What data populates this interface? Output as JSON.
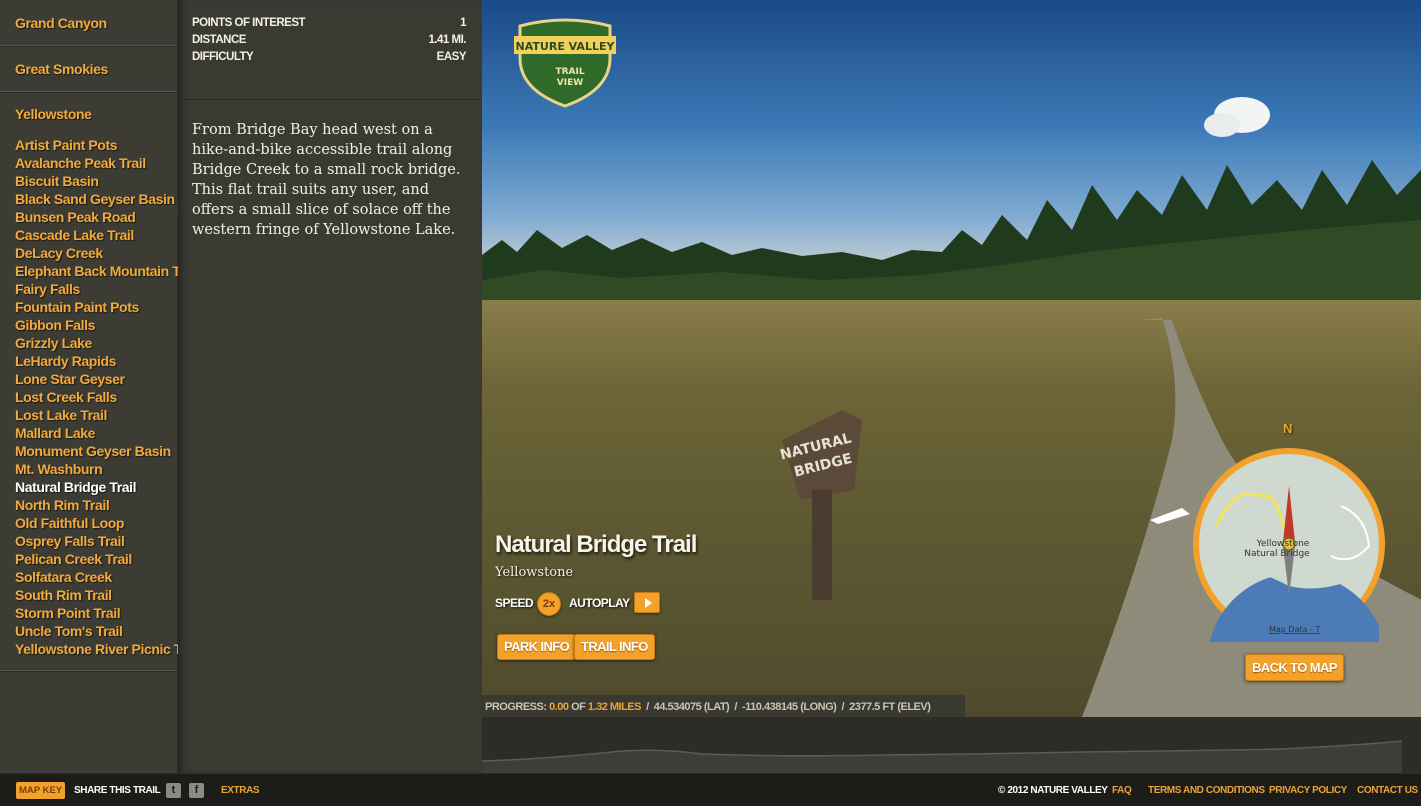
{
  "sidebar": {
    "parks": [
      "Grand Canyon",
      "Great Smokies",
      "Yellowstone"
    ],
    "trails": [
      "Artist Paint Pots",
      "Avalanche Peak Trail",
      "Biscuit Basin",
      "Black Sand Geyser Basin",
      "Bunsen Peak Road",
      "Cascade Lake Trail",
      "DeLacy Creek",
      "Elephant Back Mountain Trail",
      "Fairy Falls",
      "Fountain Paint Pots",
      "Gibbon Falls",
      "Grizzly Lake",
      "LeHardy Rapids",
      "Lone Star Geyser",
      "Lost Creek Falls",
      "Lost Lake Trail",
      "Mallard Lake",
      "Monument Geyser Basin",
      "Mt. Washburn",
      "Natural Bridge Trail",
      "North Rim Trail",
      "Old Faithful Loop",
      "Osprey Falls Trail",
      "Pelican Creek Trail",
      "Solfatara Creek",
      "South Rim Trail",
      "Storm Point Trail",
      "Uncle Tom's Trail",
      "Yellowstone River Picnic Trail"
    ],
    "selected_trail": "Natural Bridge Trail"
  },
  "info": {
    "stats": [
      {
        "label": "POINTS OF INTEREST",
        "value": "1"
      },
      {
        "label": "DISTANCE",
        "value": "1.41 MI."
      },
      {
        "label": "DIFFICULTY",
        "value": "EASY"
      }
    ],
    "description": "From Bridge Bay head west on a hike-and-bike accessible trail along Bridge Creek to a small rock bridge. This flat trail suits any user, and offers a small slice of solace off the western fringe of Yellowstone Lake."
  },
  "view": {
    "logo_text_top": "NATURE VALLEY",
    "logo_text_1": "TRAIL",
    "logo_text_2": "VIEW",
    "sign_text_1": "NATURAL",
    "sign_text_2": "BRIDGE",
    "trail_title": "Natural Bridge Trail",
    "park_name": "Yellowstone",
    "speed_label": "SPEED",
    "speed_value": "2x",
    "autoplay_label": "AUTOPLAY",
    "park_info_button": "PARK INFO",
    "trail_info_button": "TRAIL INFO",
    "compass_n": "N",
    "map_label_1": "Yellowstone",
    "map_label_2": "Natural Bridge",
    "map_data": "Map Data - T",
    "back_to_map": "BACK TO MAP",
    "progress": {
      "label": "PROGRESS:",
      "current": "0.00",
      "of": "OF",
      "total": "1.32 MILES",
      "lat": "44.534075 (LAT)",
      "long": "-110.438145 (LONG)",
      "elev": "2377.5 FT (ELEV)"
    }
  },
  "footer": {
    "map_key": "MAP KEY",
    "share": "SHARE THIS TRAIL",
    "twitter_icon": "t",
    "facebook_icon": "f",
    "extras": "EXTRAS",
    "copyright": "© 2012 NATURE VALLEY",
    "links": [
      "FAQ",
      "TERMS AND CONDITIONS",
      "PRIVACY POLICY",
      "CONTACT US"
    ]
  },
  "colors": {
    "accent": "#f2a12a",
    "sidebar_bg": "#3c3c35",
    "footer_bg": "#1c1c19"
  }
}
